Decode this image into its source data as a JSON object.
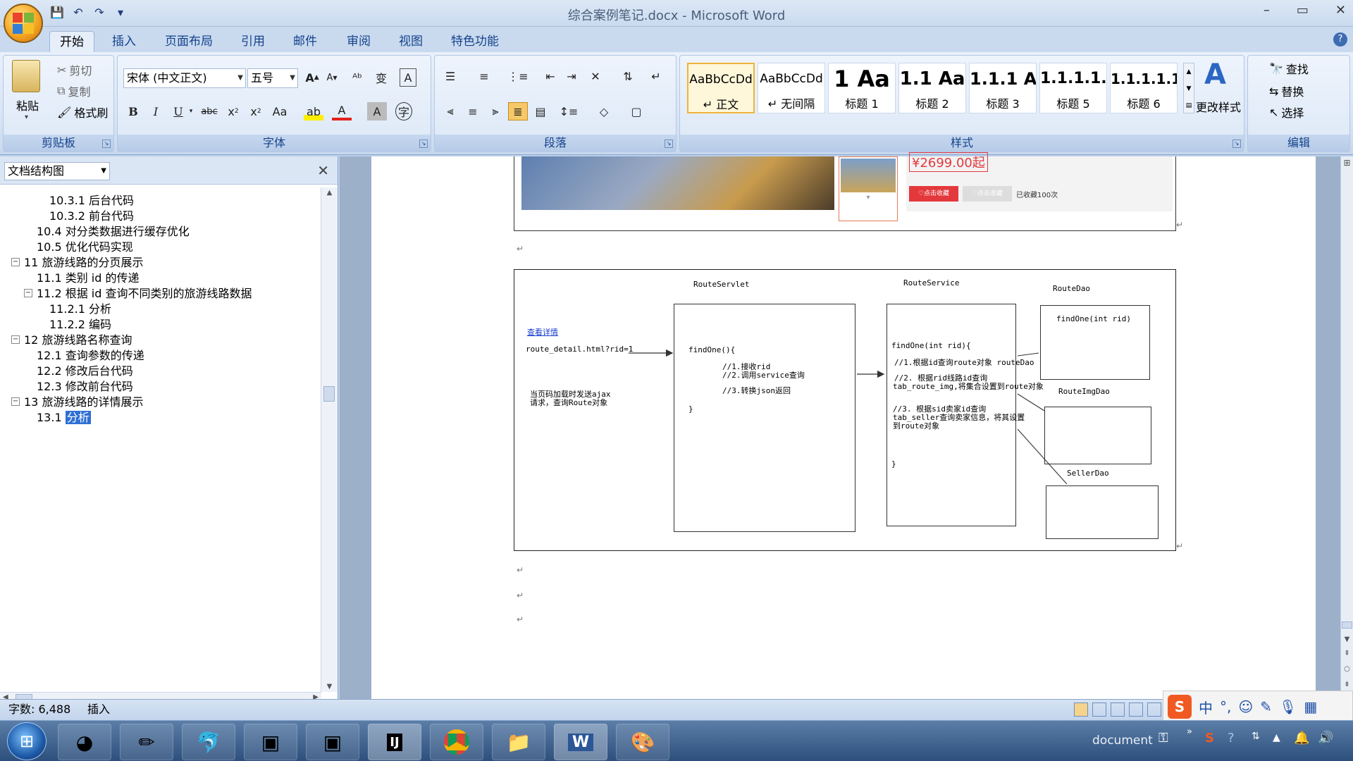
{
  "window": {
    "title": "综合案例笔记.docx - Microsoft Word",
    "controls": [
      "–",
      "▭",
      "✕"
    ]
  },
  "tabs": [
    "开始",
    "插入",
    "页面布局",
    "引用",
    "邮件",
    "审阅",
    "视图",
    "特色功能"
  ],
  "clipboard": {
    "paste": "粘贴",
    "cut": "剪切",
    "copy": "复制",
    "format_painter": "格式刷",
    "label": "剪贴板"
  },
  "font": {
    "name": "宋体 (中文正文)",
    "size": "五号",
    "label": "字体"
  },
  "paragraph": {
    "label": "段落"
  },
  "styles": {
    "items": [
      {
        "sample": "AaBbCcDd",
        "name": "↵ 正文"
      },
      {
        "sample": "AaBbCcDd",
        "name": "↵ 无间隔"
      },
      {
        "sample": "1  Aa",
        "name": "标题 1"
      },
      {
        "sample": "1.1  Aa",
        "name": "标题 2"
      },
      {
        "sample": "1.1.1  A",
        "name": "标题 3"
      },
      {
        "sample": "1.1.1.1.",
        "name": "标题 5"
      },
      {
        "sample": "1.1.1.1.1",
        "name": "标题 6"
      }
    ],
    "change": "更改样式",
    "label": "样式"
  },
  "editing": {
    "find": "查找",
    "replace": "替换",
    "select": "选择",
    "label": "编辑"
  },
  "nav": {
    "mode": "文档结构图",
    "items": [
      {
        "text": "10.3.1 后台代码",
        "level": 3
      },
      {
        "text": "10.3.2 前台代码",
        "level": 3
      },
      {
        "text": "10.4 对分类数据进行缓存优化",
        "level": 2
      },
      {
        "text": "10.5 优化代码实现",
        "level": 2
      },
      {
        "text": "11 旅游线路的分页展示",
        "level": 1
      },
      {
        "text": "11.1 类别 id 的传递",
        "level": 2
      },
      {
        "text": "11.2 根据 id 查询不同类别的旅游线路数据",
        "level": 2
      },
      {
        "text": "11.2.1  分析",
        "level": 3
      },
      {
        "text": "11.2.2 编码",
        "level": 3
      },
      {
        "text": "12 旅游线路名称查询",
        "level": 1
      },
      {
        "text": "12.1 查询参数的传递",
        "level": 2
      },
      {
        "text": "12.2 修改后台代码",
        "level": 2
      },
      {
        "text": "12.3 修改前台代码",
        "level": 2
      },
      {
        "text": "13 旅游线路的详情展示",
        "level": 1
      }
    ],
    "selected_prefix": "13.1 ",
    "selected_text": "分析"
  },
  "screenshot": {
    "price": "¥2699.00起",
    "fav_btn": "点击收藏",
    "fav_btn2": "点击收藏",
    "fav_count": "已收藏100次"
  },
  "diagram": {
    "servlet_title": "RouteServlet",
    "service_title": "RouteService",
    "dao_title": "RouteDao",
    "imgdao_title": "RouteImgDao",
    "sellerdao_title": "SellerDao",
    "link": "查看详情",
    "url": "route_detail.html?rid=1",
    "note": [
      "当页码加载时发送ajax",
      "请求，查询Route对象"
    ],
    "servlet_code": [
      "findOne(){",
      "//1.接收rid",
      "//2.调用service查询",
      "//3.转换json返回",
      "}"
    ],
    "service_code": [
      "findOne(int rid){",
      "//1.根据id查询route对象 routeDao",
      "//2. 根据rid线路id查询",
      "tab_route_img,将集合设置到route对象",
      "//3. 根据sid卖家id查询",
      "tab_seller查询卖家信息，将其设置",
      "到route对象",
      "}"
    ],
    "dao_code": "findOne(int rid)"
  },
  "status": {
    "words": "字数: 6,488",
    "mode": "插入"
  },
  "taskbar": {
    "tray_text": "document"
  }
}
